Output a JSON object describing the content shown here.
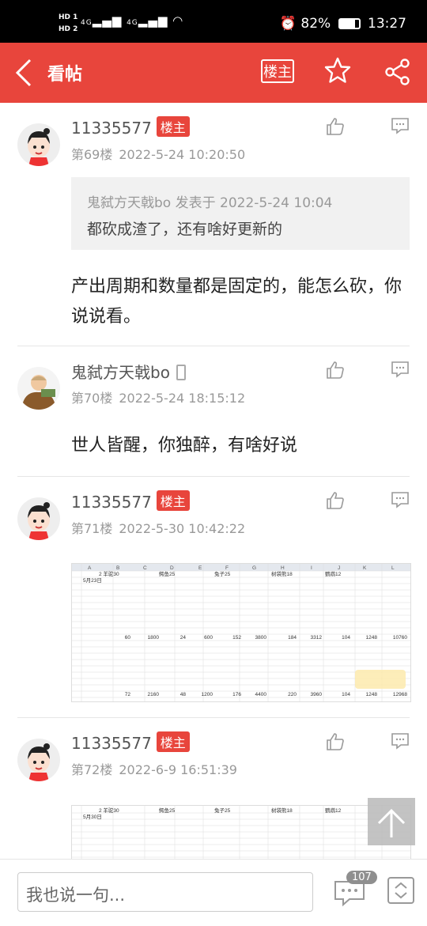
{
  "status": {
    "hd1": "HD 1",
    "hd2": "HD 2",
    "net": "4G",
    "battery": "82%",
    "time": "13:27"
  },
  "topbar": {
    "back_icon": "chevron-left-icon",
    "title": "看帖",
    "op_button": "楼主",
    "star_icon": "star-icon",
    "share_icon": "share-icon"
  },
  "posts": [
    {
      "user": "11335577",
      "badge": "楼主",
      "floor": "第69楼",
      "time": "2022-5-24 10:20:50",
      "quote_header": "鬼弑方天戟bo 发表于 2022-5-24 10:04",
      "quote_text": "都砍成渣了，还有啥好更新的",
      "body": "产出周期和数量都是固定的，能怎么砍，你说说看。"
    },
    {
      "user": "鬼弑方天戟bo",
      "floor": "第70楼",
      "time": "2022-5-24 18:15:12",
      "body": "世人皆醒，你独醉，有啥好说"
    },
    {
      "user": "11335577",
      "badge": "楼主",
      "floor": "第71楼",
      "time": "2022-5-30 10:42:22",
      "sheet": {
        "cols": [
          "A",
          "B",
          "C",
          "D",
          "E",
          "F",
          "G",
          "H",
          "I",
          "J",
          "K",
          "L"
        ],
        "headers": [
          "2 羊驼30",
          "鳄鱼25",
          "兔子25",
          "树袋熊18",
          "鹦鹉12"
        ],
        "date": "5月23日",
        "row_values": [
          "60",
          "1800",
          "24",
          "600",
          "152",
          "3800",
          "184",
          "3312",
          "104",
          "1248",
          "10760"
        ],
        "total_values": [
          "72",
          "2160",
          "48",
          "1200",
          "176",
          "4400",
          "220",
          "3960",
          "104",
          "1248",
          "12968"
        ]
      }
    },
    {
      "user": "11335577",
      "badge": "楼主",
      "floor": "第72楼",
      "time": "2022-6-9 16:51:39",
      "sheet": {
        "headers": [
          "2 羊驼30",
          "鳄鱼25",
          "兔子25",
          "树袋熊18",
          "鹦鹉12"
        ],
        "date": "5月30日"
      }
    }
  ],
  "bottom": {
    "placeholder": "我也说一句...",
    "comment_count": "107"
  }
}
